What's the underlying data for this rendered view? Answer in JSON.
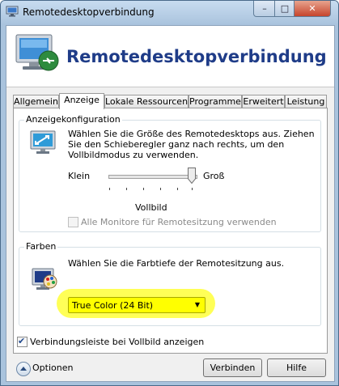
{
  "window": {
    "title": "Remotedesktopverbindung",
    "controls": {
      "minimize": "–",
      "maximize": "□",
      "close": "✕"
    }
  },
  "banner": {
    "title": "Remotedesktopverbindung",
    "icon": "remote-desktop-monitor-icon"
  },
  "tabs": [
    "Allgemein",
    "Anzeige",
    "Lokale Ressourcen",
    "Programme",
    "Erweitert",
    "Leistung"
  ],
  "active_tab": "Anzeige",
  "display_config": {
    "legend": "Anzeigekonfiguration",
    "icon": "monitor-resize-icon",
    "description": "Wählen Sie die Größe des Remotedesktops aus. Ziehen Sie den Schieberegler ganz nach rechts, um den Vollbildmodus zu verwenden.",
    "slider_min_label": "Klein",
    "slider_max_label": "Groß",
    "slider_value_label": "Vollbild",
    "slider_position_fraction": 1.0,
    "all_monitors_label": "Alle Monitore für Remotesitzung verwenden",
    "all_monitors_checked": false,
    "all_monitors_enabled": false
  },
  "colors": {
    "legend": "Farben",
    "icon": "color-palette-monitor-icon",
    "description": "Wählen Sie die Farbtiefe der Remotesitzung aus.",
    "dropdown_value": "True Color (24 Bit)",
    "highlight_color": "#ffff00"
  },
  "connection_bar": {
    "label": "Verbindungsleiste bei Vollbild anzeigen",
    "checked": true
  },
  "footer": {
    "options_label": "Optionen",
    "connect_label": "Verbinden",
    "help_label": "Hilfe"
  },
  "theme": {
    "banner_title_color": "#1f3c88",
    "frame_color": "#a9c3dd"
  }
}
